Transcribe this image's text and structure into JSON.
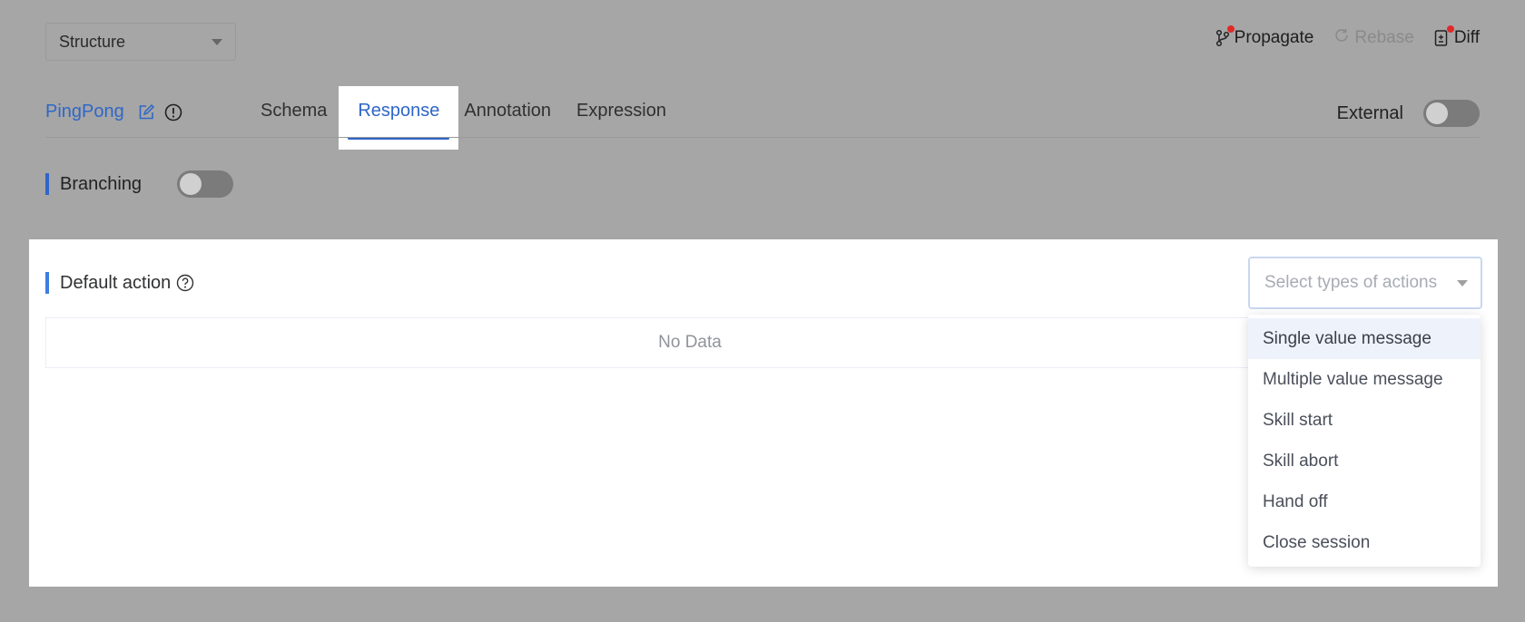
{
  "header": {
    "view_select": {
      "value": "Structure"
    },
    "actions": {
      "propagate": "Propagate",
      "rebase": "Rebase",
      "diff": "Diff"
    }
  },
  "intent": {
    "name": "PingPong",
    "tabs": [
      "Schema",
      "Response",
      "Annotation",
      "Expression"
    ],
    "active_tab": "Response",
    "external_label": "External",
    "external_on": false
  },
  "branching": {
    "label": "Branching",
    "on": false
  },
  "default_action": {
    "label": "Default action",
    "table_empty": "No Data",
    "select_placeholder": "Select types of actions",
    "options": [
      "Single value message",
      "Multiple value message",
      "Skill start",
      "Skill abort",
      "Hand off",
      "Close session"
    ],
    "highlighted_option": "Single value message"
  },
  "colors": {
    "accent": "#2f66c7",
    "overlay": "#a6a6a6"
  }
}
